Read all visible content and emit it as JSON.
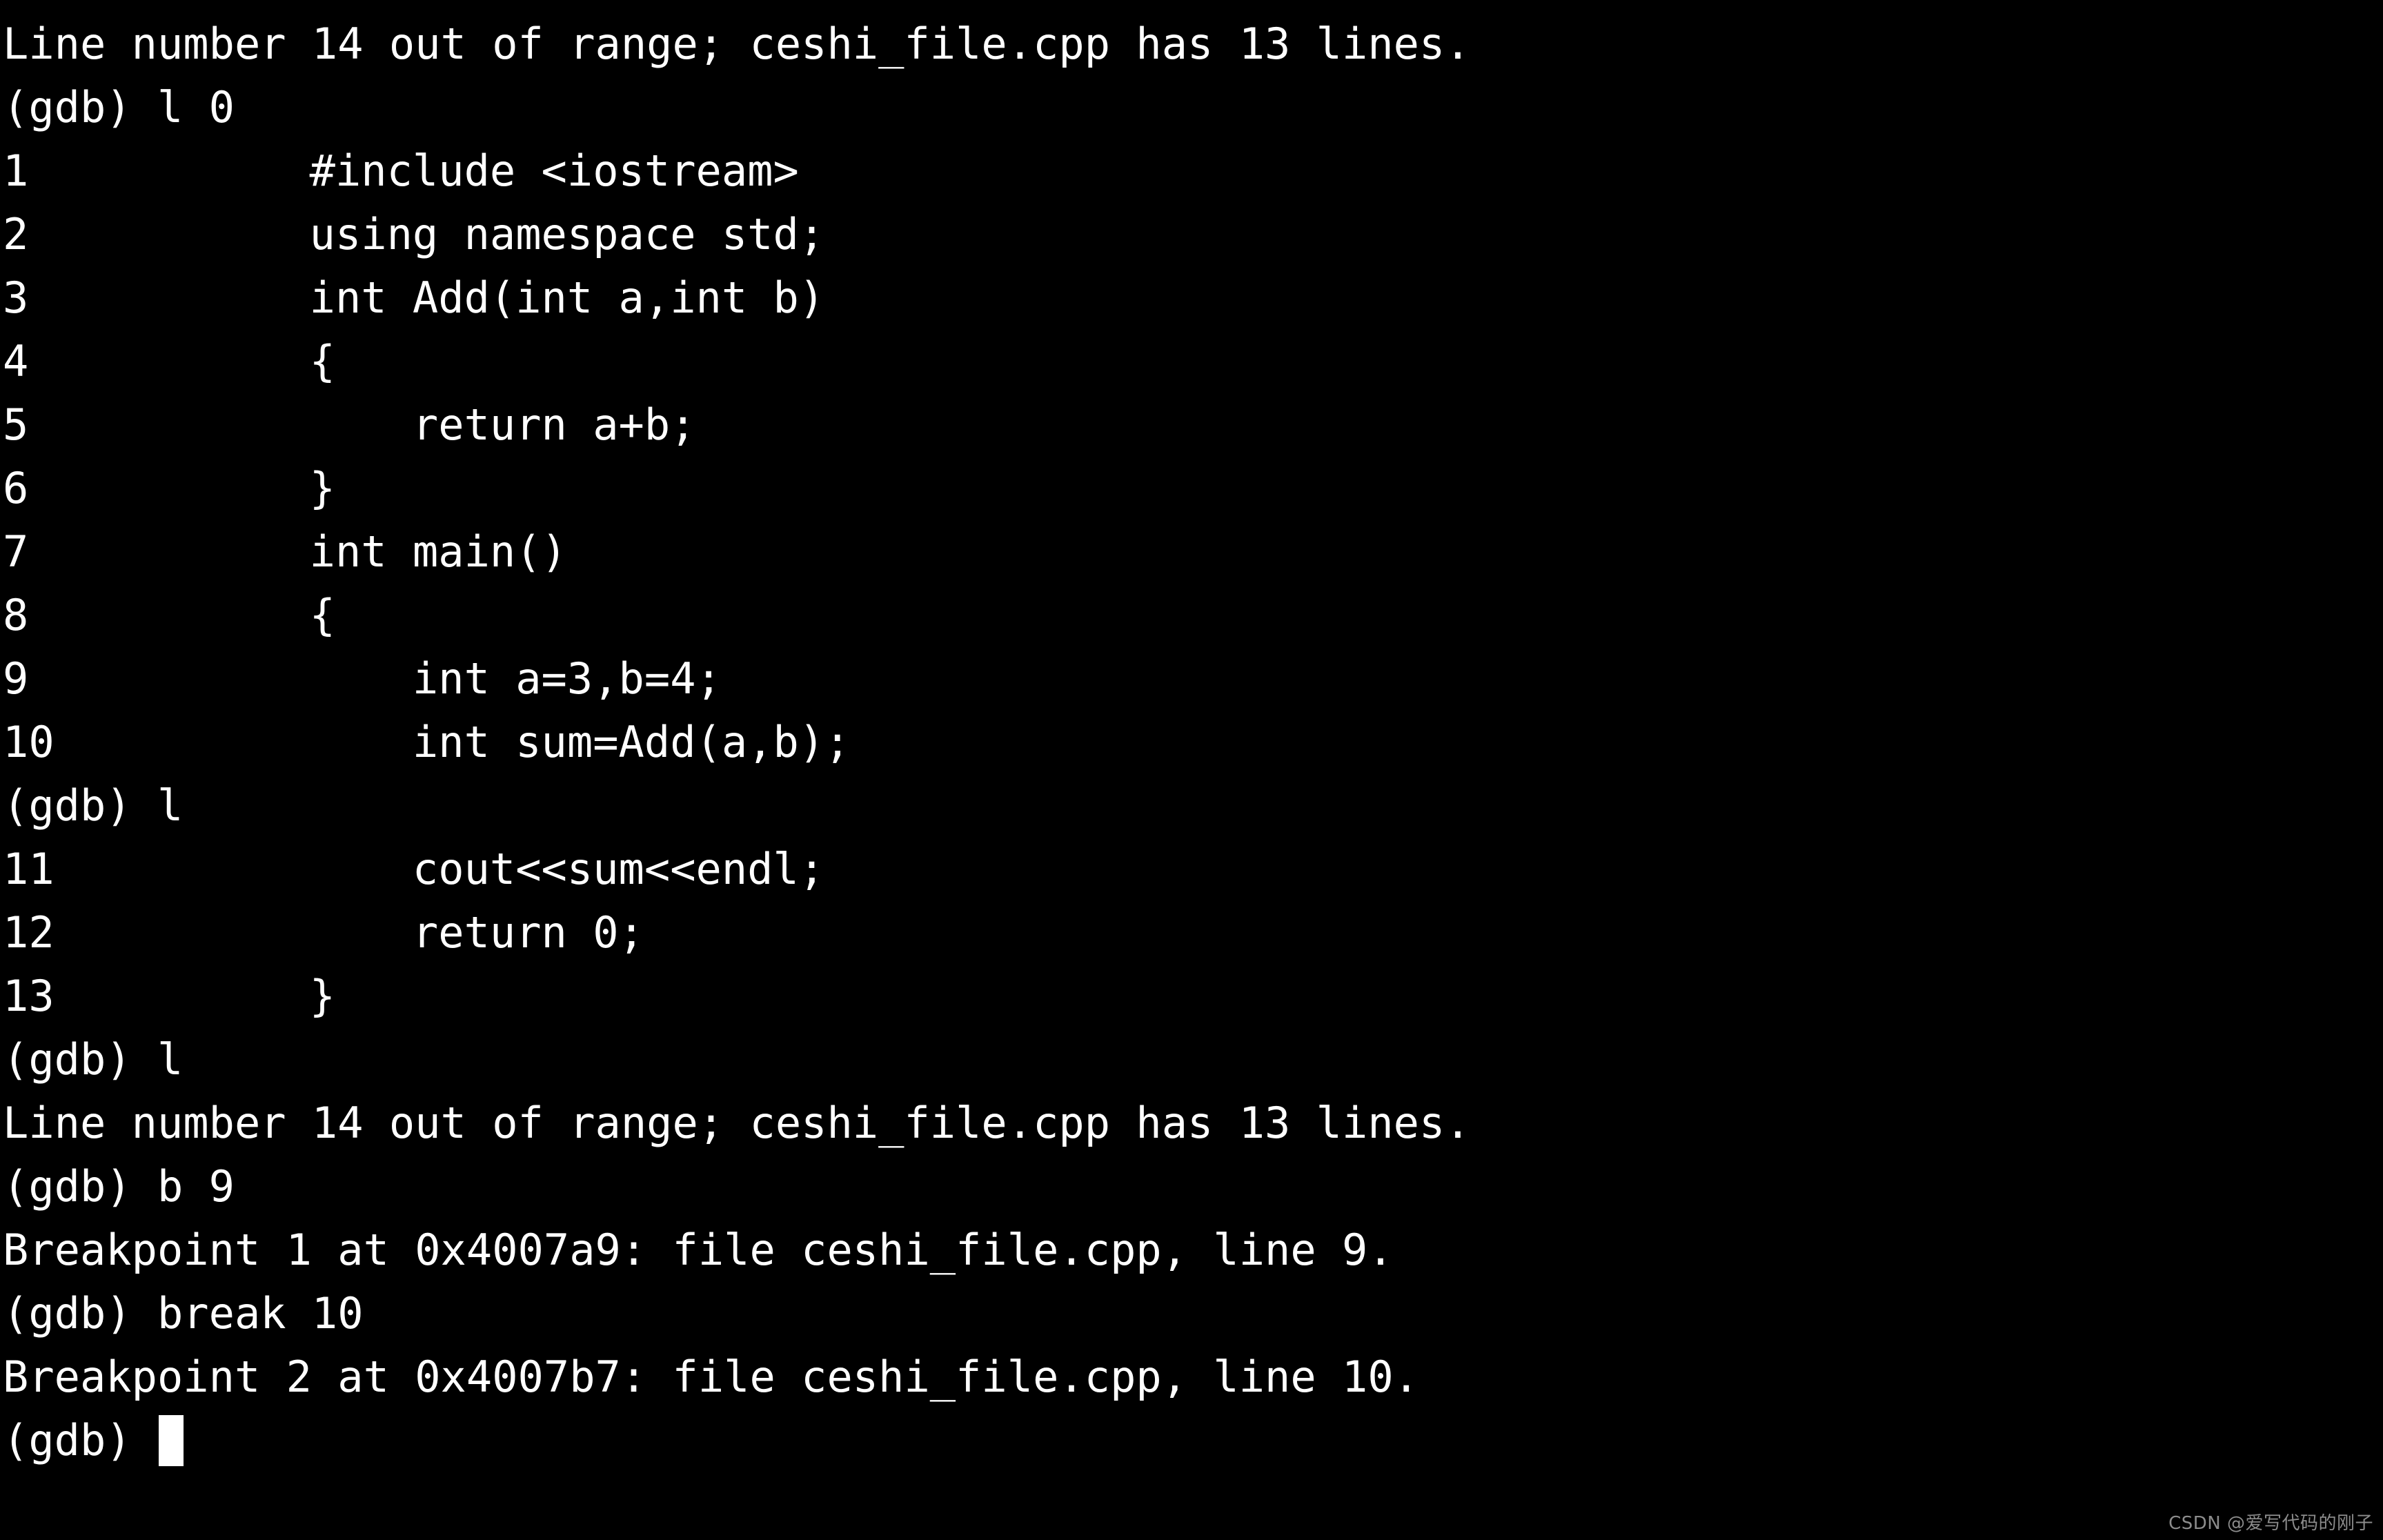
{
  "terminal": {
    "background_color": "#000000",
    "foreground_color": "#ffffff",
    "program": "gdb",
    "source_file": "ceshi_file.cpp",
    "cursor": {
      "shape": "block",
      "color": "#ffffff"
    },
    "lines": [
      {
        "kind": "message",
        "text": "Line number 14 out of range; ceshi_file.cpp has 13 lines."
      },
      {
        "kind": "prompt",
        "text": "(gdb) l 0"
      },
      {
        "kind": "source",
        "lineno": "1",
        "code": "        #include <iostream>"
      },
      {
        "kind": "source",
        "lineno": "2",
        "code": "        using namespace std;"
      },
      {
        "kind": "source",
        "lineno": "3",
        "code": "        int Add(int a,int b)"
      },
      {
        "kind": "source",
        "lineno": "4",
        "code": "        {"
      },
      {
        "kind": "source",
        "lineno": "5",
        "code": "            return a+b;"
      },
      {
        "kind": "source",
        "lineno": "6",
        "code": "        }"
      },
      {
        "kind": "source",
        "lineno": "7",
        "code": "        int main()"
      },
      {
        "kind": "source",
        "lineno": "8",
        "code": "        {"
      },
      {
        "kind": "source",
        "lineno": "9",
        "code": "            int a=3,b=4;"
      },
      {
        "kind": "source",
        "lineno": "10",
        "code": "            int sum=Add(a,b);"
      },
      {
        "kind": "prompt",
        "text": "(gdb) l"
      },
      {
        "kind": "source",
        "lineno": "11",
        "code": "            cout<<sum<<endl;"
      },
      {
        "kind": "source",
        "lineno": "12",
        "code": "            return 0;"
      },
      {
        "kind": "source",
        "lineno": "13",
        "code": "        }"
      },
      {
        "kind": "prompt",
        "text": "(gdb) l"
      },
      {
        "kind": "message",
        "text": "Line number 14 out of range; ceshi_file.cpp has 13 lines."
      },
      {
        "kind": "prompt",
        "text": "(gdb) b 9"
      },
      {
        "kind": "message",
        "text": "Breakpoint 1 at 0x4007a9: file ceshi_file.cpp, line 9."
      },
      {
        "kind": "prompt",
        "text": "(gdb) break 10"
      },
      {
        "kind": "message",
        "text": "Breakpoint 2 at 0x4007b7: file ceshi_file.cpp, line 10."
      },
      {
        "kind": "prompt-cursor",
        "text": "(gdb) "
      }
    ]
  },
  "watermark": {
    "text": "CSDN @爱写代码的刚子",
    "color": "#8c8c8c"
  }
}
